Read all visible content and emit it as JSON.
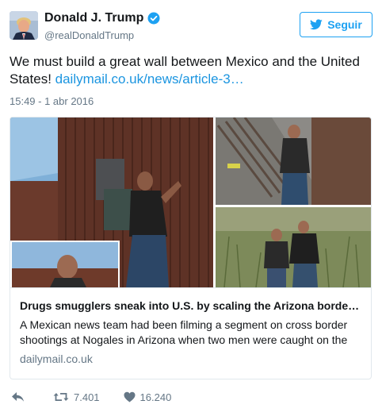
{
  "author": {
    "display_name": "Donald J. Trump",
    "handle": "@realDonaldTrump",
    "verified": true,
    "avatar_icon": "profile-photo"
  },
  "follow_button": {
    "label": "Seguir",
    "icon": "twitter-bird-icon"
  },
  "tweet": {
    "text": "We must build a great wall between Mexico and the United States! ",
    "link_text": "dailymail.co.uk/news/article-3…",
    "timestamp": "15:49 - 1 abr 2016"
  },
  "card": {
    "title": "Drugs smugglers sneak into U.S. by scaling the Arizona borde…",
    "description": "A Mexican news team had been filming a segment on cross border shootings at Nogales in Arizona when two men were caught on the",
    "domain": "dailymail.co.uk"
  },
  "actions": {
    "reply_icon": "reply-icon",
    "retweet_icon": "retweet-icon",
    "retweet_count": "7.401",
    "like_icon": "heart-icon",
    "like_count": "16.240"
  },
  "colors": {
    "accent": "#1da1f2",
    "link": "#1b95e0",
    "muted": "#657786",
    "text": "#14171a",
    "border": "#e1e8ed"
  }
}
